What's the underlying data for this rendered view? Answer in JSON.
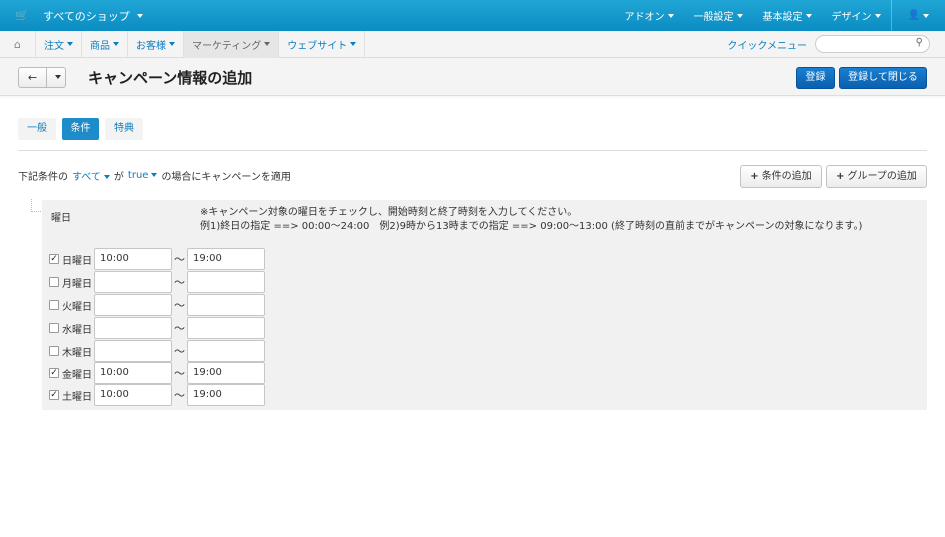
{
  "topbar": {
    "shop_label": "すべてのショップ",
    "menu": [
      "アドオン",
      "一般設定",
      "基本設定",
      "デザイン"
    ]
  },
  "navbar": {
    "items": [
      {
        "label": "注文",
        "active": false
      },
      {
        "label": "商品",
        "active": false
      },
      {
        "label": "お客様",
        "active": false
      },
      {
        "label": "マーケティング",
        "active": true
      },
      {
        "label": "ウェブサイト",
        "active": false
      }
    ],
    "quick_menu": "クイックメニュー",
    "search_placeholder": ""
  },
  "page": {
    "title": "キャンペーン情報の追加",
    "save_label": "登録",
    "save_close_label": "登録して閉じる"
  },
  "tabs": [
    "一般",
    "条件",
    "特典"
  ],
  "conditions": {
    "prefix": "下記条件の",
    "mode": "すべて",
    "ga": "が",
    "value": "true",
    "suffix": "の場合にキャンペーンを適用",
    "add_condition": "条件の追加",
    "add_group": "グループの追加"
  },
  "weekday_rule": {
    "label": "曜日",
    "note_line1": "※キャンペーン対象の曜日をチェックし、開始時刻と終了時刻を入力してください。",
    "note_line2": "例1)終日の指定 ==> 00:00～24:00　例2)9時から13時までの指定 ==> 09:00～13:00 (終了時刻の直前までがキャンペーンの対象になります。)",
    "tilde": "～",
    "days": [
      {
        "name": "日曜日",
        "checked": true,
        "start": "10:00",
        "end": "19:00"
      },
      {
        "name": "月曜日",
        "checked": false,
        "start": "",
        "end": ""
      },
      {
        "name": "火曜日",
        "checked": false,
        "start": "",
        "end": ""
      },
      {
        "name": "水曜日",
        "checked": false,
        "start": "",
        "end": ""
      },
      {
        "name": "木曜日",
        "checked": false,
        "start": "",
        "end": ""
      },
      {
        "name": "金曜日",
        "checked": true,
        "start": "10:00",
        "end": "19:00"
      },
      {
        "name": "土曜日",
        "checked": true,
        "start": "10:00",
        "end": "19:00"
      }
    ]
  }
}
